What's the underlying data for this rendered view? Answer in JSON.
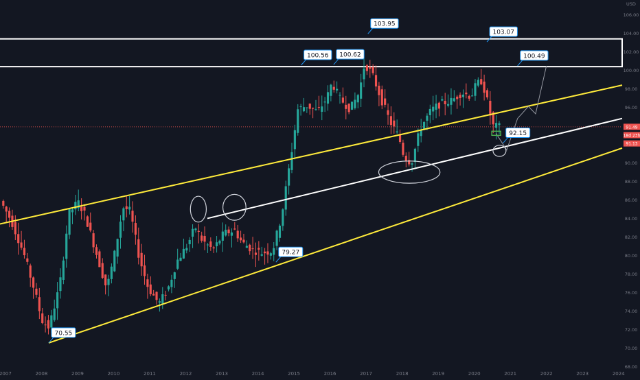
{
  "chart_data": {
    "type": "candlestick",
    "currency_label": "USD",
    "x_ticks": [
      "2007",
      "2008",
      "2009",
      "2010",
      "2011",
      "2012",
      "2013",
      "2014",
      "2015",
      "2016",
      "2017",
      "2018",
      "2019",
      "2020",
      "2021",
      "2022",
      "2023",
      "2024"
    ],
    "y_ticks": [
      68,
      70,
      72,
      74,
      76,
      78,
      80,
      82,
      84,
      86,
      88,
      90,
      92,
      94,
      96,
      98,
      100,
      102,
      104,
      106
    ],
    "ylim": [
      67.8,
      107.6
    ],
    "xlim": [
      2006.85,
      2024.1
    ],
    "grid": false,
    "colors": {
      "up": "#26a69a",
      "down": "#ef5350",
      "channel": "#ffeb3b",
      "midline": "#ffffff",
      "box": "#ffffff",
      "price_line": "#ef5350",
      "label_border": "#2196f3",
      "background": "#131722",
      "axis_text": "#787b86"
    },
    "price_tags": [
      {
        "text": "91.49",
        "value": 93.9,
        "color": "#ef5350"
      },
      {
        "text": "18d 23h",
        "value": 93.0,
        "color": "#ef5350"
      },
      {
        "text": "91.13",
        "value": 92.1,
        "color": "#ef5350"
      }
    ],
    "annotations": [
      {
        "text": "70.55",
        "x": 2008.2,
        "value": 70.55
      },
      {
        "text": "79.27",
        "x": 2014.5,
        "value": 79.27
      },
      {
        "text": "100.56",
        "x": 2015.2,
        "value": 100.56
      },
      {
        "text": "100.62",
        "x": 2016.1,
        "value": 100.62
      },
      {
        "text": "103.95",
        "x": 2017.05,
        "value": 103.95
      },
      {
        "text": "103.07",
        "x": 2020.35,
        "value": 103.07
      },
      {
        "text": "100.49",
        "x": 2021.2,
        "value": 100.49
      },
      {
        "text": "92.15",
        "x": 2020.8,
        "value": 92.15
      }
    ],
    "resistance_zone": [
      100.4,
      103.4
    ],
    "channel_upper": [
      [
        2006.85,
        83.4
      ],
      [
        2024.1,
        98.4
      ]
    ],
    "channel_lower": [
      [
        2008.2,
        70.55
      ],
      [
        2024.1,
        91.6
      ]
    ],
    "midline": [
      [
        2012.6,
        84.0
      ],
      [
        2024.1,
        94.8
      ]
    ],
    "projection": [
      [
        2020.6,
        93.2
      ],
      [
        2020.9,
        91.4
      ],
      [
        2021.2,
        94.8
      ],
      [
        2021.5,
        96.1
      ],
      [
        2021.7,
        95.3
      ],
      [
        2022.0,
        100.49
      ]
    ],
    "ellipses": [
      {
        "cx": 2012.35,
        "cy": 85.0,
        "rx": 0.22,
        "ry": 1.4
      },
      {
        "cx": 2013.35,
        "cy": 85.2,
        "rx": 0.32,
        "ry": 1.4
      },
      {
        "cx": 2018.2,
        "cy": 89.0,
        "rx": 0.85,
        "ry": 1.2
      },
      {
        "cx": 2020.7,
        "cy": 91.3,
        "rx": 0.18,
        "ry": 0.6
      }
    ],
    "target_box": {
      "x": 2020.6,
      "value": 93.2
    },
    "current_price": 93.9,
    "waypoints": [
      [
        2006.9,
        85.9
      ],
      [
        2007.2,
        83.8
      ],
      [
        2007.55,
        80.2
      ],
      [
        2007.85,
        76.2
      ],
      [
        2008.05,
        73.0
      ],
      [
        2008.25,
        72.2
      ],
      [
        2008.55,
        76.8
      ],
      [
        2008.8,
        84.5
      ],
      [
        2009.05,
        85.8
      ],
      [
        2009.25,
        84.4
      ],
      [
        2009.55,
        80.4
      ],
      [
        2009.85,
        76.4
      ],
      [
        2010.05,
        79.8
      ],
      [
        2010.3,
        85.2
      ],
      [
        2010.5,
        84.8
      ],
      [
        2010.75,
        79.8
      ],
      [
        2011.0,
        76.5
      ],
      [
        2011.3,
        74.8
      ],
      [
        2011.55,
        76.4
      ],
      [
        2011.8,
        79.4
      ],
      [
        2012.1,
        81.2
      ],
      [
        2012.3,
        83.1
      ],
      [
        2012.5,
        81.6
      ],
      [
        2012.8,
        80.6
      ],
      [
        2013.1,
        82.4
      ],
      [
        2013.4,
        82.7
      ],
      [
        2013.6,
        81.4
      ],
      [
        2013.9,
        80.6
      ],
      [
        2014.15,
        80.3
      ],
      [
        2014.45,
        80.5
      ],
      [
        2014.7,
        84.3
      ],
      [
        2014.95,
        90.5
      ],
      [
        2015.15,
        95.8
      ],
      [
        2015.4,
        96.2
      ],
      [
        2015.7,
        95.5
      ],
      [
        2015.95,
        97.0
      ],
      [
        2016.1,
        98.7
      ],
      [
        2016.3,
        97.0
      ],
      [
        2016.6,
        95.8
      ],
      [
        2016.85,
        97.6
      ],
      [
        2017.0,
        100.7
      ],
      [
        2017.2,
        99.7
      ],
      [
        2017.45,
        97.0
      ],
      [
        2017.7,
        94.5
      ],
      [
        2017.95,
        92.8
      ],
      [
        2018.1,
        90.6
      ],
      [
        2018.3,
        90.0
      ],
      [
        2018.55,
        93.8
      ],
      [
        2018.85,
        95.7
      ],
      [
        2019.1,
        96.4
      ],
      [
        2019.4,
        96.7
      ],
      [
        2019.7,
        97.6
      ],
      [
        2019.95,
        97.2
      ],
      [
        2020.1,
        98.5
      ],
      [
        2020.25,
        98.9
      ],
      [
        2020.4,
        96.7
      ],
      [
        2020.55,
        94.0
      ],
      [
        2020.7,
        93.9
      ]
    ]
  }
}
